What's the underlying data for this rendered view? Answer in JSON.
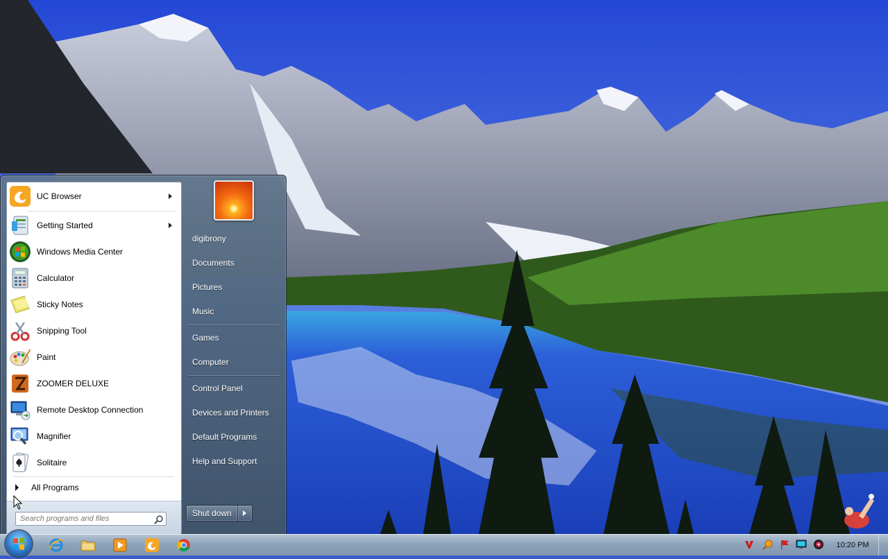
{
  "start_menu": {
    "programs": [
      {
        "label": "UC Browser",
        "icon": "uc-browser-icon",
        "has_submenu": true
      },
      {
        "label": "Getting Started",
        "icon": "getting-started-icon",
        "has_submenu": true
      },
      {
        "label": "Windows Media Center",
        "icon": "media-center-icon",
        "has_submenu": false
      },
      {
        "label": "Calculator",
        "icon": "calculator-icon",
        "has_submenu": false
      },
      {
        "label": "Sticky Notes",
        "icon": "sticky-notes-icon",
        "has_submenu": false
      },
      {
        "label": "Snipping Tool",
        "icon": "snipping-tool-icon",
        "has_submenu": false
      },
      {
        "label": "Paint",
        "icon": "paint-icon",
        "has_submenu": false
      },
      {
        "label": "ZOOMER DELUXE",
        "icon": "zoomer-deluxe-icon",
        "has_submenu": false
      },
      {
        "label": "Remote Desktop Connection",
        "icon": "remote-desktop-icon",
        "has_submenu": false
      },
      {
        "label": "Magnifier",
        "icon": "magnifier-icon",
        "has_submenu": false
      },
      {
        "label": "Solitaire",
        "icon": "solitaire-icon",
        "has_submenu": false
      }
    ],
    "all_programs_label": "All Programs",
    "search_placeholder": "Search programs and files",
    "user_name": "digibrony",
    "right_links": [
      "Documents",
      "Pictures",
      "Music",
      "Games",
      "Computer",
      "Control Panel",
      "Devices and Printers",
      "Default Programs",
      "Help and Support"
    ],
    "shutdown_label": "Shut down"
  },
  "taskbar": {
    "pinned": [
      "internet-explorer-icon",
      "file-explorer-icon",
      "media-player-icon",
      "uc-browser-icon",
      "chrome-icon"
    ],
    "tray": [
      "antivirus-icon",
      "search-tray-icon",
      "flag-icon",
      "network-icon",
      "volume-icon"
    ],
    "clock": "10:20 PM"
  },
  "colors": {
    "sky": "#2a56d8",
    "taskbar": "#8ea4bb",
    "start_menu_right": "#5a7088"
  }
}
